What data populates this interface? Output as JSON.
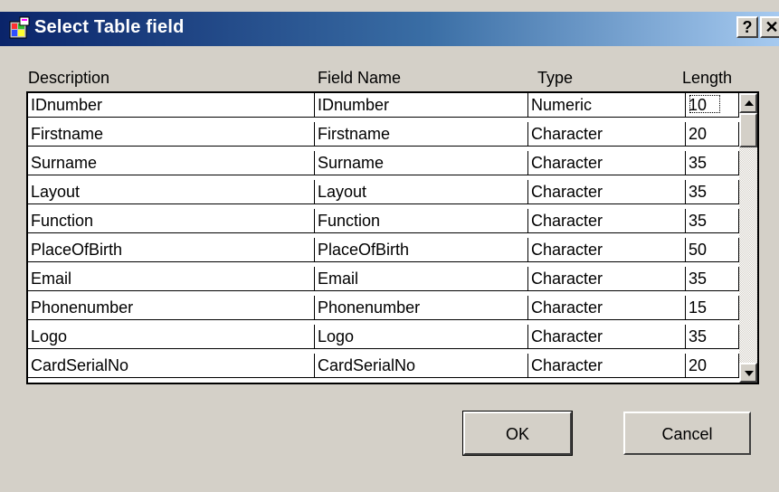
{
  "window": {
    "title": "Select Table field",
    "help_label": "?",
    "close_label": "✕"
  },
  "table": {
    "headers": [
      "Description",
      "Field Name",
      "Type",
      "Length"
    ],
    "rows": [
      [
        "IDnumber",
        "IDnumber",
        "Numeric",
        "10"
      ],
      [
        "Firstname",
        "Firstname",
        "Character",
        "20"
      ],
      [
        "Surname",
        "Surname",
        "Character",
        "35"
      ],
      [
        "Layout",
        "Layout",
        "Character",
        "35"
      ],
      [
        "Function",
        "Function",
        "Character",
        "35"
      ],
      [
        "PlaceOfBirth",
        "PlaceOfBirth",
        "Character",
        "50"
      ],
      [
        "Email",
        "Email",
        "Character",
        "35"
      ],
      [
        "Phonenumber",
        "Phonenumber",
        "Character",
        "15"
      ],
      [
        "Logo",
        "Logo",
        "Character",
        "35"
      ],
      [
        "CardSerialNo",
        "CardSerialNo",
        "Character",
        "20"
      ]
    ]
  },
  "buttons": {
    "ok": "OK",
    "cancel": "Cancel"
  },
  "colors": {
    "titlebar_start": "#0a246a",
    "titlebar_end": "#a6caf0",
    "dialog_bg": "#d4d0c8"
  },
  "icons": {
    "app": "app-icon",
    "scroll_up": "arrow-up-icon",
    "scroll_down": "arrow-down-icon"
  }
}
